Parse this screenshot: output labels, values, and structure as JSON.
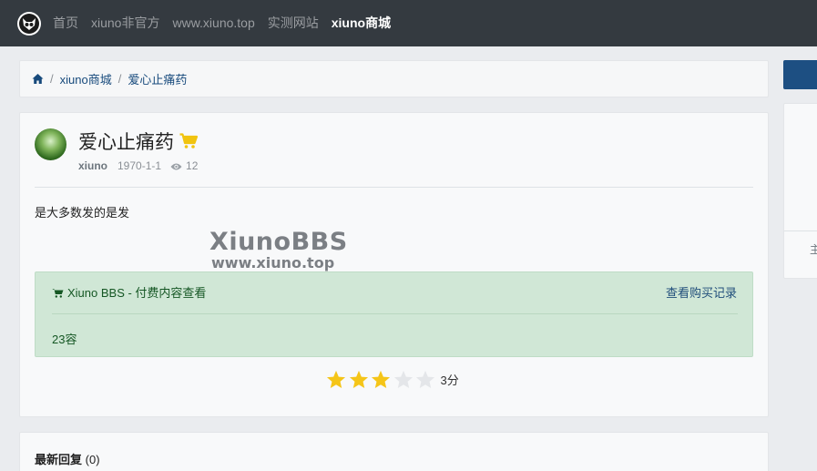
{
  "navbar": {
    "logo": "owl-logo-icon",
    "links": [
      {
        "label": "首页",
        "active": false
      },
      {
        "label": "xiuno非官方",
        "active": false
      },
      {
        "label": "www.xiuno.top",
        "active": false
      },
      {
        "label": "实测网站",
        "active": false
      },
      {
        "label": "xiuno商城",
        "active": true
      }
    ]
  },
  "breadcrumb": {
    "home_icon": "home-icon",
    "items": [
      "xiuno商城",
      "爱心止痛药"
    ],
    "separator": "/"
  },
  "thread": {
    "title": "爱心止痛药",
    "title_icon": "shopping-cart-icon",
    "author": "xiuno",
    "date": "1970-1-1",
    "views": "12",
    "body": "是大多数发的是发"
  },
  "watermark": {
    "main": "XiunoBBS",
    "sub": "www.xiuno.top"
  },
  "paid_box": {
    "header": "Xiuno BBS - 付费内容查看",
    "purchase_link": "查看购买记录",
    "content": "23容"
  },
  "rating": {
    "stars_filled": 3,
    "stars_total": 5,
    "score_label": "3分"
  },
  "replies": {
    "title": "最新回复",
    "count": "(0)"
  },
  "sidebar": {
    "text": "主"
  },
  "colors": {
    "navbar_bg": "#343a40",
    "accent": "#1d4f82",
    "paid_bg": "#d0e7d6",
    "star": "#f5c518"
  }
}
